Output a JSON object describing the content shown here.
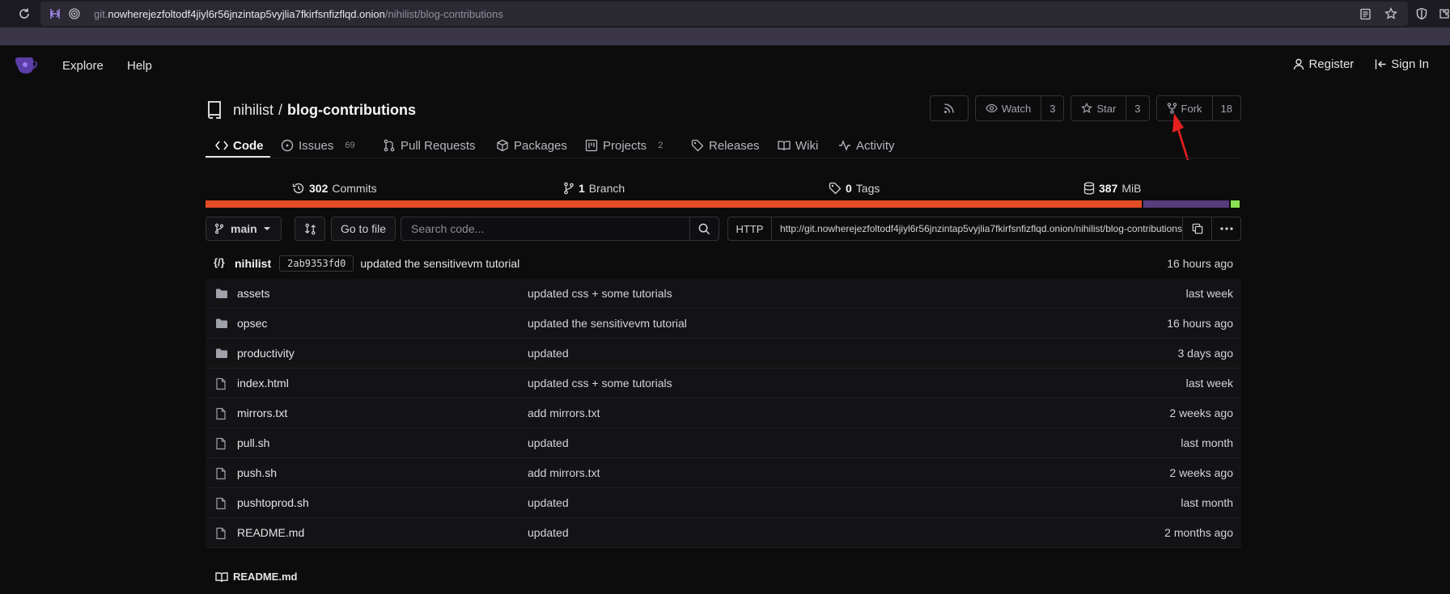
{
  "browser": {
    "url_prefix": "git.",
    "url_host": "nowherejezfoltodf4jiyl6r56jnzintap5vyjlia7fkirfsnfizflqd.onion",
    "url_path": "/nihilist/blog-contributions"
  },
  "site_nav": {
    "explore": "Explore",
    "help": "Help",
    "register": "Register",
    "sign_in": "Sign In"
  },
  "repo": {
    "owner": "nihilist",
    "separator": "/",
    "name": "blog-contributions",
    "watch_label": "Watch",
    "watch_count": "3",
    "star_label": "Star",
    "star_count": "3",
    "fork_label": "Fork",
    "fork_count": "18"
  },
  "tabs": {
    "code": "Code",
    "issues": "Issues",
    "issues_count": "69",
    "pulls": "Pull Requests",
    "packages": "Packages",
    "projects": "Projects",
    "projects_count": "2",
    "releases": "Releases",
    "wiki": "Wiki",
    "activity": "Activity"
  },
  "stats": {
    "commits_count": "302",
    "commits_label": "Commits",
    "branches_count": "1",
    "branches_label": "Branch",
    "tags_count": "0",
    "tags_label": "Tags",
    "size_count": "387",
    "size_label": "MiB"
  },
  "languages": [
    {
      "color": "#e34c26",
      "fraction": 0.908
    },
    {
      "color": "#563d7c",
      "fraction": 0.083
    },
    {
      "color": "#89e051",
      "fraction": 0.009
    }
  ],
  "toolbar": {
    "branch": "main",
    "goto_file": "Go to file",
    "search_placeholder": "Search code...",
    "protocol": "HTTP",
    "clone_url": "http://git.nowherejezfoltodf4jiyl6r56jnzintap5vyjlia7fkirfsnfizflqd.onion/nihilist/blog-contributions.git"
  },
  "latest_commit": {
    "avatar_text": "{/}",
    "author": "nihilist",
    "sha": "2ab9353fd0",
    "message": "updated the sensitivevm tutorial",
    "when": "16 hours ago"
  },
  "files": [
    {
      "type": "folder",
      "name": "assets",
      "message": "updated css + some tutorials",
      "when": "last week"
    },
    {
      "type": "folder",
      "name": "opsec",
      "message": "updated the sensitivevm tutorial",
      "when": "16 hours ago"
    },
    {
      "type": "folder",
      "name": "productivity",
      "message": "updated",
      "when": "3 days ago"
    },
    {
      "type": "file",
      "name": "index.html",
      "message": "updated css + some tutorials",
      "when": "last week"
    },
    {
      "type": "file",
      "name": "mirrors.txt",
      "message": "add mirrors.txt",
      "when": "2 weeks ago"
    },
    {
      "type": "file",
      "name": "pull.sh",
      "message": "updated",
      "when": "last month"
    },
    {
      "type": "file",
      "name": "push.sh",
      "message": "add mirrors.txt",
      "when": "2 weeks ago"
    },
    {
      "type": "file",
      "name": "pushtoprod.sh",
      "message": "updated",
      "when": "last month"
    },
    {
      "type": "file",
      "name": "README.md",
      "message": "updated",
      "when": "2 months ago"
    }
  ],
  "readme": {
    "title": "README.md"
  },
  "colors": {
    "annotation_arrow": "#e8201f"
  }
}
